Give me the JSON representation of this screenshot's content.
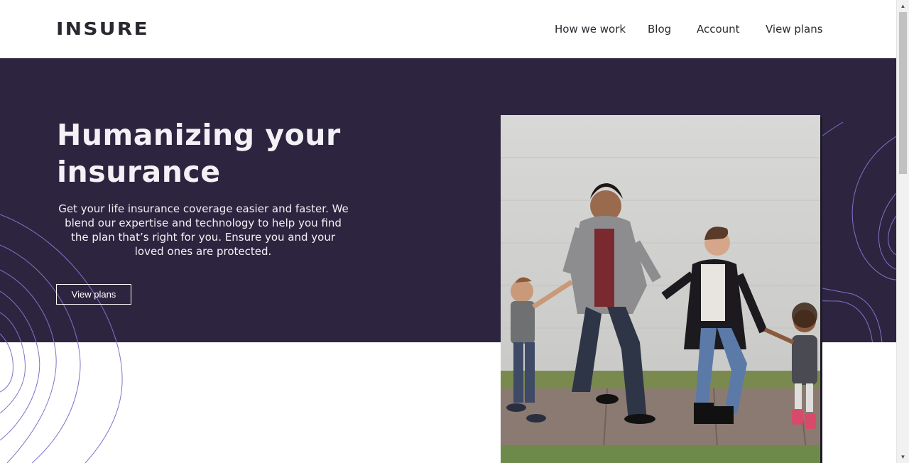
{
  "header": {
    "logo": "INSURE",
    "nav": [
      {
        "label": "How we work"
      },
      {
        "label": "Blog"
      },
      {
        "label": "Account"
      },
      {
        "label": "View plans"
      }
    ]
  },
  "hero": {
    "title": "Humanizing your insurance",
    "text": "Get your life insurance coverage easier and faster. We blend our expertise and technology to help you find the plan that’s right for you. Ensure you and your loved ones are protected.",
    "button_label": "View plans"
  },
  "colors": {
    "hero_bg": "#2d253f",
    "text_dark": "#2c2830",
    "decor_lines": "#7b74c9"
  },
  "icons": {
    "scroll_up": "triangle-up",
    "scroll_down": "triangle-down"
  }
}
